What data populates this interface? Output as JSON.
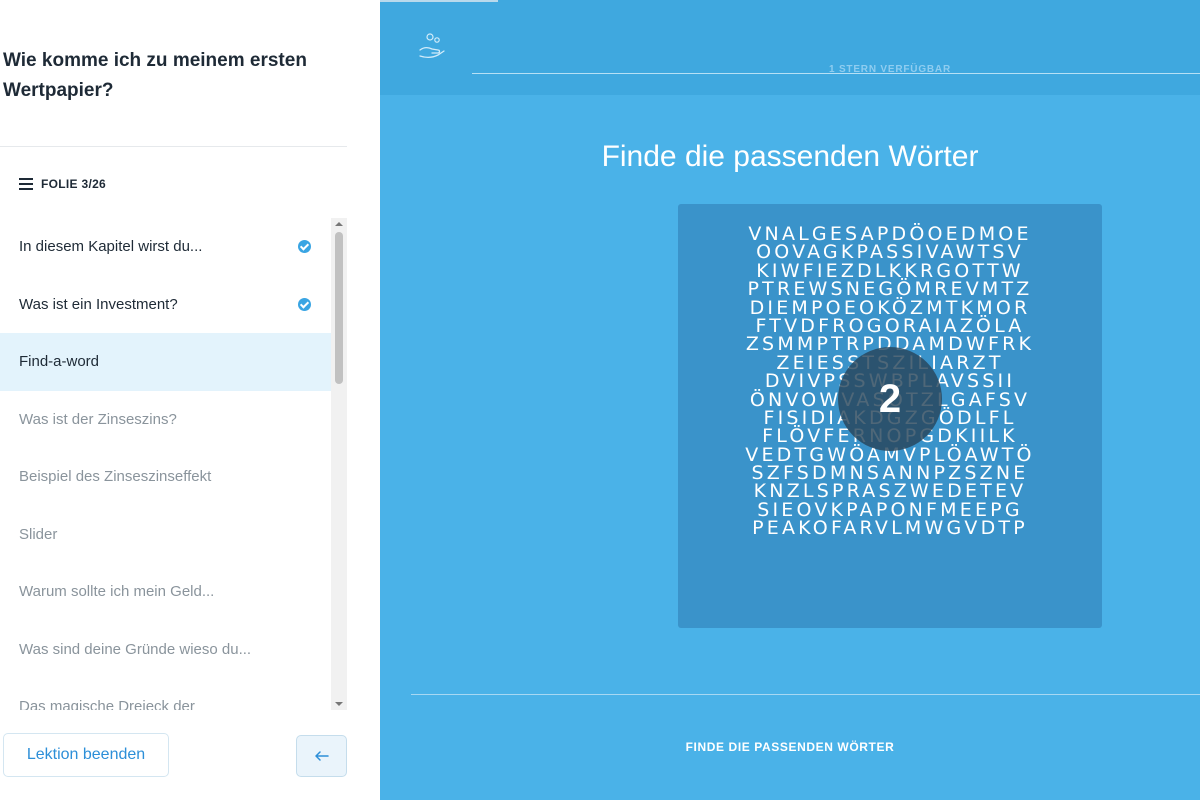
{
  "sidebar": {
    "course_title": "Wie komme ich zu meinem ersten Wertpapier?",
    "slide_counter": "FOLIE 3/26",
    "items": [
      {
        "label": "In diesem Kapitel wirst du...",
        "state": "done"
      },
      {
        "label": "Was ist ein Investment?",
        "state": "done"
      },
      {
        "label": "Find-a-word",
        "state": "active"
      },
      {
        "label": "Was ist der Zinseszins?",
        "state": "todo"
      },
      {
        "label": "Beispiel des Zinseszinseffekt",
        "state": "todo"
      },
      {
        "label": "Slider",
        "state": "todo"
      },
      {
        "label": "Warum sollte ich mein Geld...",
        "state": "todo"
      },
      {
        "label": "Was sind deine Gründe wieso du...",
        "state": "todo"
      },
      {
        "label": "Das magische Dreieck der",
        "state": "todo"
      }
    ],
    "end_button": "Lektion beenden",
    "back_button_icon": "arrow-left-icon"
  },
  "main": {
    "stars_text": "1 STERN VERFÜGBAR",
    "game_title": "Finde die passenden Wörter",
    "grid": [
      "VNALGESAPDÖOEDMOE",
      "OOVAGKPASSIVAWTSV",
      "KIWFIEZDLKKRGOTTW",
      "PTREWSNEGÖMREVMTZ",
      "DIEMPOEOKÖZMTKMOR",
      "FTVDFROGORAIAZÖLA",
      "ZSMMPTRPDDAMDWFRK",
      "ZEIESSTSZILIARZT",
      "DVIVPSSWBPLAVSSII",
      "ÖNVOWVASÖTZLGAFSV",
      "FISIDIAKDGZGÖDLFL",
      "FLÖVFERNOPGDKIILK",
      "VEDTGWÖAMVPLÖAWTÖ",
      "SZFSDMNSANNPZSZNE",
      "KNZLSPRASZWEDETEV",
      "SIEOVKPAPONFMEEPG",
      "PEAKOFARVLMWGVDTP"
    ],
    "countdown": "2",
    "bottom_label": "FINDE DIE PASSENDEN WÖRTER"
  },
  "colors": {
    "accent": "#3aa5e3",
    "main_bg": "#4ab2e8",
    "active_item_bg": "#e3f3fc"
  }
}
